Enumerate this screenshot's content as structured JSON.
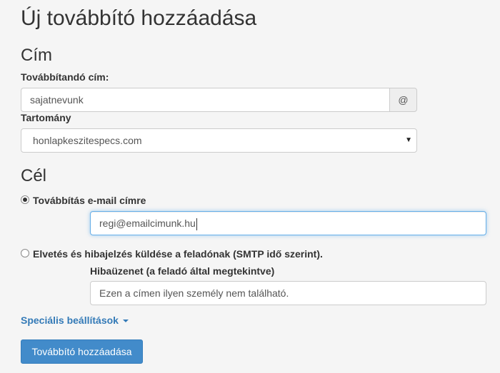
{
  "page": {
    "title": "Új továbbító hozzáadása"
  },
  "address": {
    "section_title": "Cím",
    "forward_label": "Továbbítandó cím:",
    "forward_value": "sajatnevunk",
    "at_addon": "@",
    "domain_label": "Tartomány",
    "domain_value": "honlapkeszitespecs.com"
  },
  "destination": {
    "section_title": "Cél",
    "option_forward": {
      "label": "Továbbítás e-mail címre",
      "checked": true,
      "email_value": "regi@emailcimunk.hu"
    },
    "option_discard": {
      "label": "Elvetés és hibajelzés küldése a feladónak (SMTP idő szerint).",
      "checked": false,
      "message_label": "Hibaüzenet (a feladó által megtekintve)",
      "message_value": "Ezen a címen ilyen személy nem található."
    }
  },
  "advanced": {
    "label": "Speciális beállítások"
  },
  "submit": {
    "label": "Továbbító hozzáadása"
  },
  "colors": {
    "background": "#f5f5f5",
    "link": "#337ab7",
    "primary_button": "#428bca",
    "focus_border": "#66afe9"
  }
}
